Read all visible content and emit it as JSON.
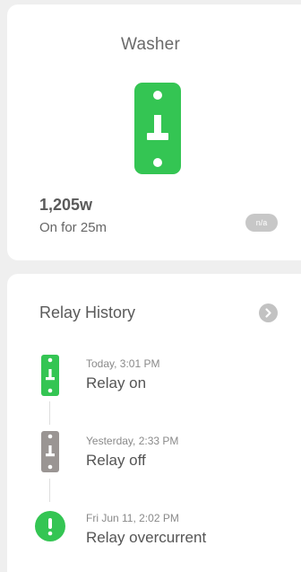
{
  "device": {
    "name": "Washer",
    "power": "1,205w",
    "on_duration": "On for 25m",
    "badge": "n/a",
    "icon": "plug-on-icon"
  },
  "history": {
    "title": "Relay History",
    "open_icon": "chevron-right-icon",
    "events": [
      {
        "time": "Today, 3:01 PM",
        "label": "Relay on",
        "icon": "plug-on-icon",
        "color": "#34c553"
      },
      {
        "time": "Yesterday, 2:33 PM",
        "label": "Relay off",
        "icon": "plug-off-icon",
        "color": "#9a9593"
      },
      {
        "time": "Fri Jun 11, 2:02 PM",
        "label": "Relay overcurrent",
        "icon": "alert-circle-icon",
        "color": "#34c553"
      }
    ]
  },
  "colors": {
    "on": "#34c553",
    "off": "#9a9593",
    "background": "#efefef",
    "card": "#ffffff"
  }
}
